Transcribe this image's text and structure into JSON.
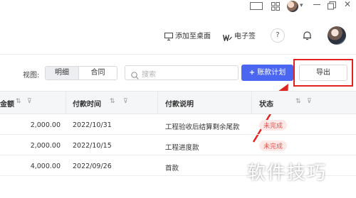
{
  "header": {
    "add_to_desktop": "添加至桌面",
    "e_sign": "电子签",
    "help": "?"
  },
  "toolbar": {
    "view_label": "视图:",
    "view_options": [
      "明细",
      "合同"
    ],
    "view_selected": "明细",
    "search_placeholder": "搜索",
    "primary_button": "账款计划",
    "export_button": "导出"
  },
  "table": {
    "columns": [
      "金额",
      "付款时间",
      "付款说明",
      "状态"
    ],
    "rows": [
      {
        "amount": "2,000.00",
        "date": "2022/10/31",
        "desc": "工程验收后结算剩余尾款",
        "status": "未完成"
      },
      {
        "amount": "2,000.00",
        "date": "2022/10/15",
        "desc": "工程进度款",
        "status": "未完成"
      },
      {
        "amount": "4,000.00",
        "date": "2022/09/26",
        "desc": "首款",
        "status": ""
      }
    ]
  },
  "annotation": {
    "color": "#e0231e"
  },
  "colors": {
    "primary": "#4b66f0",
    "status_text": "#e5534b",
    "status_bg": "#fde9e8"
  },
  "watermark": "软件技巧"
}
